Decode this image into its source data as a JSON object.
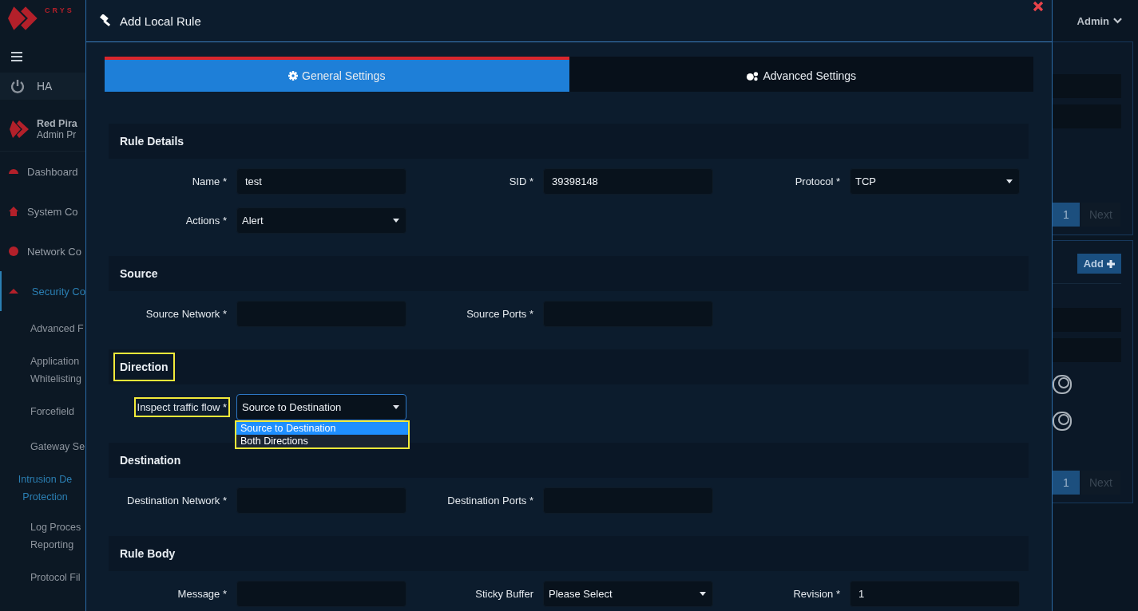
{
  "sidebar": {
    "brand": "CRYS",
    "ha_label": "HA",
    "profile": {
      "name": "Red Pira",
      "role": "Admin Pr"
    },
    "items": [
      {
        "label": "Dashboard",
        "selected": false
      },
      {
        "label": "System Co",
        "selected": false
      },
      {
        "label": "Network Co",
        "selected": false
      },
      {
        "label": "Security Co",
        "selected": true,
        "expanded": true,
        "children": [
          {
            "lines": [
              "Advanced F"
            ],
            "selected": false
          },
          {
            "lines": [
              "Application",
              "Whitelisting"
            ],
            "selected": false
          },
          {
            "lines": [
              "Forcefield"
            ],
            "selected": false
          },
          {
            "lines": [
              "Gateway Se"
            ],
            "selected": false
          },
          {
            "lines": [
              "Intrusion De",
              "Protection"
            ],
            "selected": true
          },
          {
            "lines": [
              "Log Proces",
              "Reporting"
            ],
            "selected": false
          },
          {
            "lines": [
              "Protocol Fil"
            ],
            "selected": false
          }
        ]
      }
    ]
  },
  "topbar": {
    "user": "Admin"
  },
  "background_panels": [
    {
      "pages": [
        {
          "label": "1",
          "selected": true
        },
        {
          "label": "Next",
          "selected": false
        }
      ]
    },
    {
      "add_button": "Add",
      "toggles": [
        {
          "on": false
        },
        {
          "on": false
        }
      ],
      "pages": [
        {
          "label": "1",
          "selected": true
        },
        {
          "label": "Next",
          "selected": false
        }
      ]
    }
  ],
  "dialog": {
    "title": "Add Local Rule",
    "tabs": [
      {
        "label": "General Settings",
        "selected": true
      },
      {
        "label": "Advanced Settings",
        "selected": false
      }
    ],
    "sections": [
      {
        "title": "Rule Details",
        "highlighted": false,
        "fields": [
          {
            "label": "Name *",
            "kind": "text",
            "value": "test"
          },
          {
            "label": "SID *",
            "kind": "text",
            "value": "39398148"
          },
          {
            "label": "Protocol *",
            "kind": "select",
            "value": "TCP"
          },
          {
            "label": "Actions *",
            "kind": "select",
            "value": "Alert"
          }
        ]
      },
      {
        "title": "Source",
        "highlighted": false,
        "fields": [
          {
            "label": "Source Network *",
            "kind": "text"
          },
          {
            "label": "Source Ports *",
            "kind": "text"
          }
        ]
      },
      {
        "title": "Direction",
        "highlighted": true,
        "fields": [
          {
            "label": "Inspect traffic flow *",
            "kind": "select",
            "value": "Source to Destination",
            "highlighted": true,
            "focused": true,
            "open": true,
            "options_highlighted": true,
            "options": [
              {
                "label": "Source to Destination",
                "selected": true
              },
              {
                "label": "Both Directions",
                "selected": false
              }
            ]
          }
        ]
      },
      {
        "title": "Destination",
        "highlighted": false,
        "fields": [
          {
            "label": "Destination Network *",
            "kind": "text"
          },
          {
            "label": "Destination Ports *",
            "kind": "text"
          }
        ]
      },
      {
        "title": "Rule Body",
        "highlighted": false,
        "fields": [
          {
            "label": "Message *",
            "kind": "text"
          },
          {
            "label": "Sticky Buffer",
            "kind": "select",
            "value": "Please Select"
          },
          {
            "label": "Revision *",
            "kind": "text",
            "value": "1"
          }
        ]
      }
    ]
  }
}
